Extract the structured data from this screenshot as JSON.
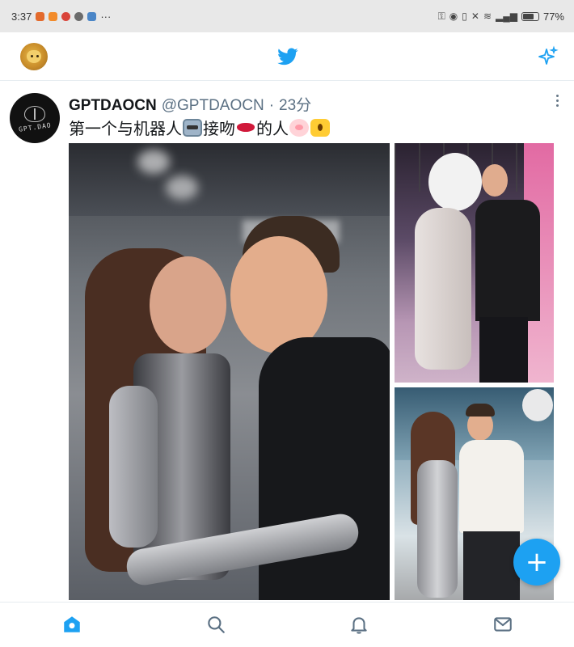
{
  "status_bar": {
    "time": "3:37",
    "notification_icons": [
      "weibo-icon",
      "mail-app-icon",
      "app-icon",
      "app-icon",
      "person-icon"
    ],
    "more": "···",
    "system_icons": [
      "key-icon",
      "eye-icon",
      "vibrate-icon",
      "mute-icon",
      "wifi-icon",
      "signal-icon"
    ],
    "battery_percent": "77%",
    "battery_level": 0.77
  },
  "header": {
    "logo_icon": "twitter-bird-icon",
    "right_icon": "sparkle-icon"
  },
  "tweet": {
    "display_name": "GPTDAOCN",
    "handle": "@GPTDAOCN",
    "separator": "·",
    "time": "23分",
    "avatar_text": "GPT.DAO",
    "text_parts": [
      "第一个与机器人",
      "接吻",
      "的人"
    ],
    "emojis": [
      "robot-emoji",
      "kiss-lips-emoji",
      "pig-emoji",
      "scream-emoji"
    ],
    "images": [
      "photo-main",
      "photo-top-right",
      "photo-bottom-right"
    ]
  },
  "fab": {
    "label": "+"
  },
  "bottom_nav": {
    "items": [
      "home-icon",
      "search-icon",
      "notifications-icon",
      "messages-icon"
    ],
    "active": "home-icon",
    "accent": "#1da1f2"
  },
  "colors": {
    "accent": "#1da1f2",
    "text": "#14171a",
    "secondary_text": "#5b7083"
  }
}
